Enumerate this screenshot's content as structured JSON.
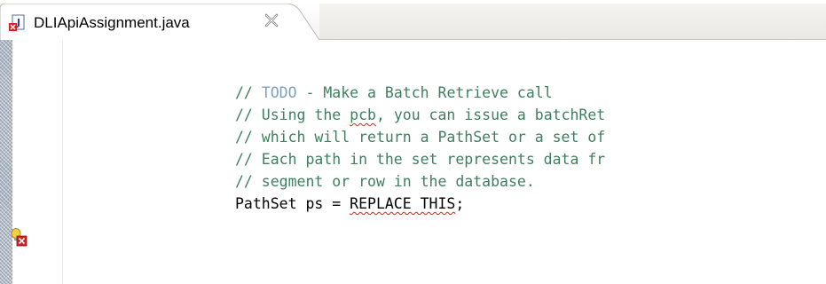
{
  "editor": {
    "tab": {
      "title": "DLIApiAssignment.java",
      "icon": "java-file-error-icon",
      "close_icon": "close-icon"
    },
    "code_lines": [
      {
        "prefix": "// ",
        "todo": "TODO",
        "suffix": " - Make a Batch Retrieve call"
      },
      {
        "before": "// Using the ",
        "squiggle": "pcb",
        "after": ", you can issue a batchRet"
      },
      {
        "text": "// which will return a PathSet or a set of"
      },
      {
        "text": "// Each path in the set represents data fr"
      },
      {
        "text": "// segment or row in the database."
      },
      {
        "before": "PathSet ps = ",
        "squiggle": "REPLACE THIS",
        "after": ";"
      }
    ],
    "gutter_marker": "quickfix-error-icon",
    "colors": {
      "comment": "#3f7f5f",
      "todo": "#7f9fbf",
      "error_squiggle": "#e0201a",
      "code": "#000000"
    }
  }
}
